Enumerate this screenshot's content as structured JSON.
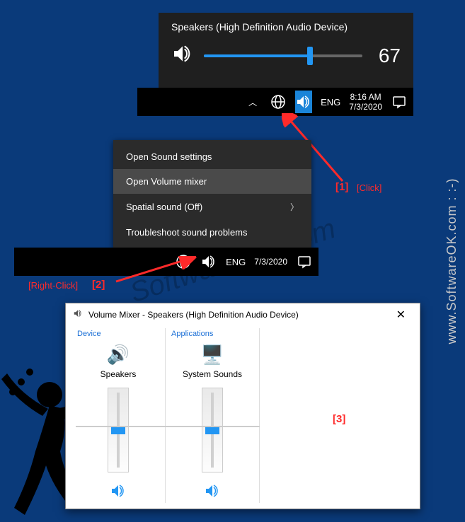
{
  "watermark": {
    "side": "www.SoftwareOK.com : :-)",
    "center": "SoftwareOK.com"
  },
  "volumeFlyout": {
    "title": "Speakers (High Definition Audio Device)",
    "value": "67",
    "percent": 67
  },
  "taskbar1": {
    "lang": "ENG",
    "time": "8:16 AM",
    "date": "7/3/2020"
  },
  "contextMenu": {
    "items": [
      {
        "label": "Open Sound settings",
        "hover": false,
        "submenu": false
      },
      {
        "label": "Open Volume mixer",
        "hover": true,
        "submenu": false
      },
      {
        "label": "Spatial sound (Off)",
        "hover": false,
        "submenu": true
      },
      {
        "label": "Troubleshoot sound problems",
        "hover": false,
        "submenu": false
      }
    ]
  },
  "taskbar2": {
    "lang": "ENG",
    "date": "7/3/2020"
  },
  "annotations": {
    "a1": "[1]",
    "a1b": "[Click]",
    "a2a": "[Right-Click]",
    "a2": "[2]",
    "a3": "[3]"
  },
  "mixer": {
    "title": "Volume Mixer - Speakers (High Definition Audio Device)",
    "sections": {
      "device": "Device",
      "apps": "Applications"
    },
    "device": {
      "name": "Speakers",
      "level": 50
    },
    "apps": [
      {
        "name": "System Sounds",
        "level": 50
      }
    ]
  }
}
